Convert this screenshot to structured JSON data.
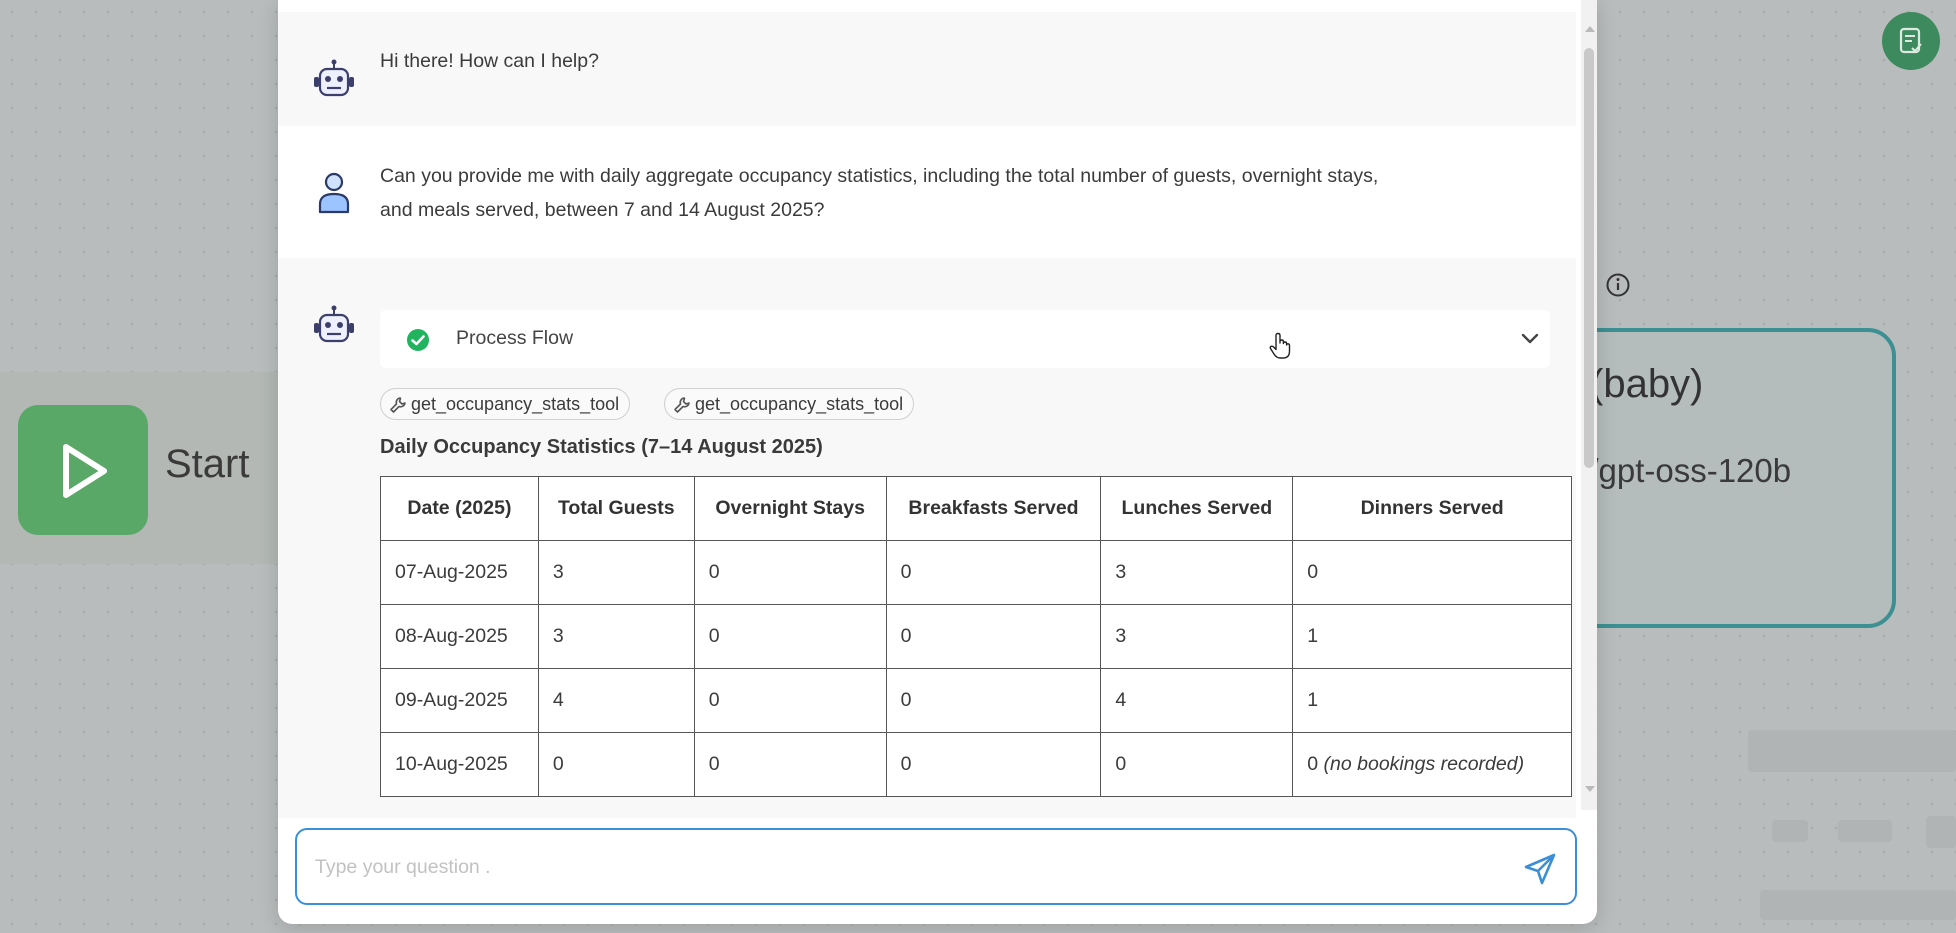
{
  "background": {
    "start_label": "Start",
    "llm_node_title": "(baby)",
    "llm_node_model": "i/gpt-oss-120b"
  },
  "chat": {
    "bot_greeting": "Hi there! How can I help?",
    "user_message_line1": "Can you provide me with daily aggregate occupancy statistics, including the total number of guests, overnight stays,",
    "user_message_line2": "and meals served, between 7 and 14 August 2025?",
    "process_flow_label": "Process Flow",
    "tool_calls": [
      "get_occupancy_stats_tool",
      "get_occupancy_stats_tool"
    ],
    "table_title": "Daily Occupancy Statistics (7–14 August 2025)",
    "table": {
      "headers": [
        "Date (2025)",
        "Total Guests",
        "Overnight Stays",
        "Breakfasts Served",
        "Lunches Served",
        "Dinners Served"
      ],
      "rows": [
        [
          "07-Aug-2025",
          "3",
          "0",
          "0",
          "3",
          "0"
        ],
        [
          "08-Aug-2025",
          "3",
          "0",
          "0",
          "3",
          "1"
        ],
        [
          "09-Aug-2025",
          "4",
          "0",
          "0",
          "4",
          "1"
        ],
        [
          "10-Aug-2025",
          "0",
          "0",
          "0",
          "0",
          "0"
        ]
      ],
      "row4_note": "(no bookings recorded)"
    },
    "input_placeholder": "Type your question ."
  },
  "colors": {
    "accent": "#3a8fd6",
    "success": "#22b35e",
    "start_node": "#5aa868",
    "llm_border": "#3c8f92"
  },
  "icons": [
    "robot-icon",
    "user-icon",
    "check-circle-icon",
    "chevron-down-icon",
    "wrench-icon",
    "send-icon",
    "play-icon",
    "info-icon",
    "notes-icon",
    "hand-cursor-icon"
  ]
}
